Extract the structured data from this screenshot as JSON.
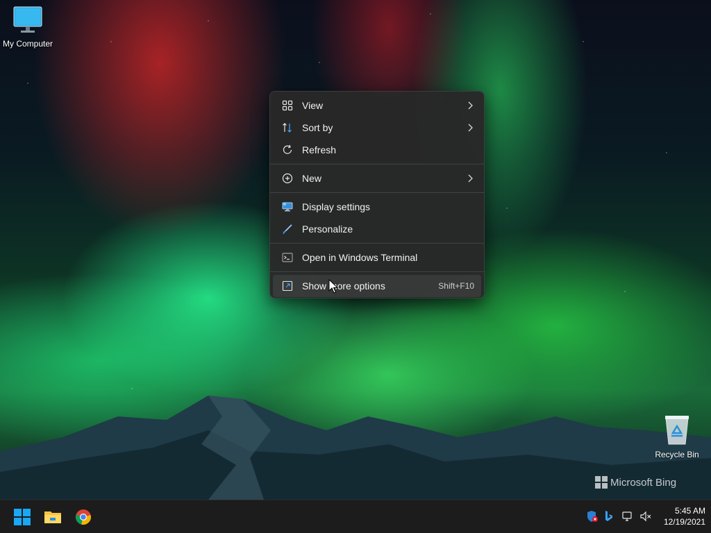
{
  "desktop": {
    "icons": [
      {
        "label": "My Computer",
        "icon": "monitor-icon"
      },
      {
        "label": "Recycle Bin",
        "icon": "recycle-bin-icon"
      }
    ],
    "watermark": "Microsoft Bing"
  },
  "context_menu": {
    "items": [
      {
        "label": "View",
        "icon": "grid-icon",
        "submenu": true
      },
      {
        "label": "Sort by",
        "icon": "sort-icon",
        "submenu": true
      },
      {
        "label": "Refresh",
        "icon": "refresh-icon"
      },
      {
        "label": "New",
        "icon": "plus-circle-icon",
        "submenu": true
      },
      {
        "label": "Display settings",
        "icon": "display-icon"
      },
      {
        "label": "Personalize",
        "icon": "brush-icon"
      },
      {
        "label": "Open in Windows Terminal",
        "icon": "terminal-icon"
      },
      {
        "label": "Show more options",
        "icon": "expand-icon",
        "shortcut": "Shift+F10",
        "highlighted": true
      }
    ]
  },
  "taskbar": {
    "apps": [
      "start-icon",
      "file-explorer-icon",
      "chrome-icon"
    ],
    "tray": [
      "defender-icon",
      "bing-icon",
      "network-icon",
      "volume-muted-icon"
    ],
    "clock": {
      "time": "5:45 AM",
      "date": "12/19/2021"
    }
  },
  "colors": {
    "menu_bg": "#282828",
    "taskbar_bg": "#1c1c1c",
    "start_blue": "#0f9df0"
  }
}
